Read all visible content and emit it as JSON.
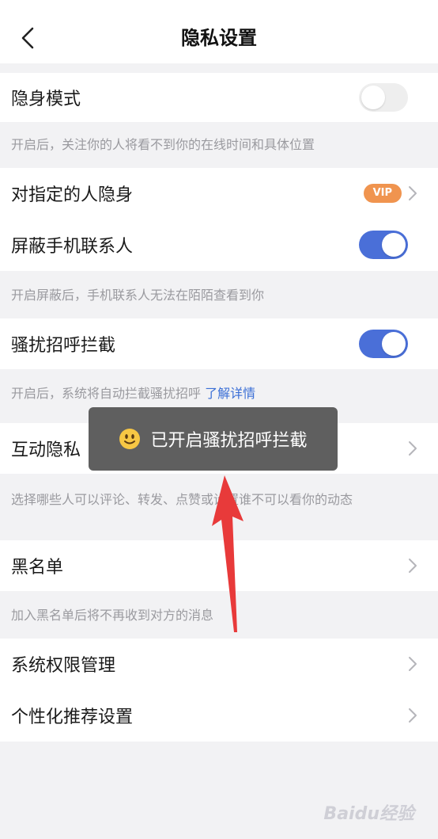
{
  "header": {
    "title": "隐私设置",
    "back_icon": "chevron-left-icon"
  },
  "rows": {
    "stealth": {
      "label": "隐身模式",
      "toggle": "off"
    },
    "stealth_hint": "开启后，关注你的人将看不到你的在线时间和具体位置",
    "hide_specific": {
      "label": "对指定的人隐身",
      "badge": "VIP"
    },
    "block_contacts": {
      "label": "屏蔽手机联系人",
      "toggle": "on"
    },
    "block_contacts_hint": "开启屏蔽后，手机联系人无法在陌陌查看到你",
    "harass": {
      "label": "骚扰招呼拦截",
      "toggle": "on"
    },
    "harass_hint": "开启后，系统将自动拦截骚扰招呼",
    "harass_link": "了解详情",
    "interact": {
      "label": "互动隐私"
    },
    "interact_hint": "选择哪些人可以评论、转发、点赞或设置谁不可以看你的动态",
    "blacklist": {
      "label": "黑名单"
    },
    "blacklist_hint": "加入黑名单后将不再收到对方的消息",
    "permissions": {
      "label": "系统权限管理"
    },
    "personalize": {
      "label": "个性化推荐设置"
    }
  },
  "toast": {
    "text": "已开启骚扰招呼拦截",
    "icon": "smiley-emoji-icon"
  },
  "watermark": "Baidu经验",
  "colors": {
    "accent": "#4a6fd8",
    "vip": "#f0944f",
    "link": "#3b6fd6",
    "arrow": "#e83a3a"
  }
}
